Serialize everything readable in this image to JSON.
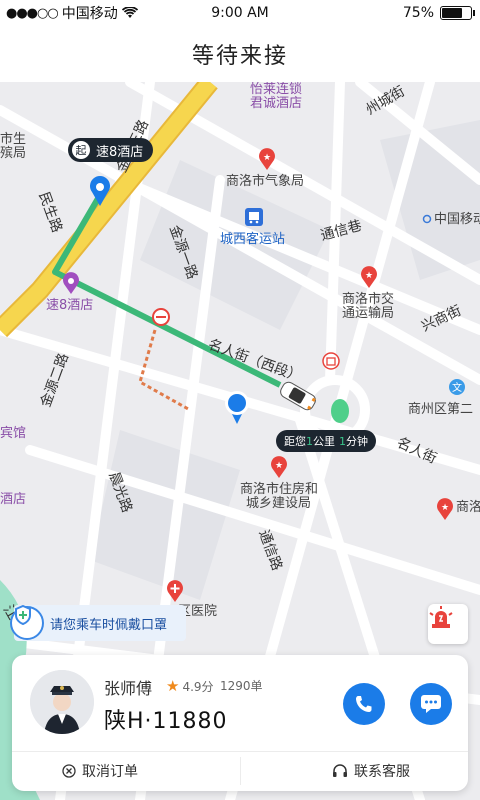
{
  "status_bar": {
    "signal_dots": "●●●○○",
    "carrier": "中国移动",
    "time": "9:00 AM",
    "battery": "75%",
    "battery_level": 0.75
  },
  "nav": {
    "title": "等待来接"
  },
  "map": {
    "pois": [
      {
        "text": "怡莱连锁",
        "style": "purple"
      },
      {
        "text": "君诚酒店",
        "style": "purple"
      },
      {
        "text": "州城街",
        "style": "road"
      },
      {
        "text": "商洛市气象局",
        "style": "normal"
      },
      {
        "text": "城西客运站",
        "style": "blue"
      },
      {
        "text": "通信巷",
        "style": "road"
      },
      {
        "text": "中国移动",
        "style": "normal"
      },
      {
        "text": "商洛市交",
        "style": "normal"
      },
      {
        "text": "通运输局",
        "style": "normal"
      },
      {
        "text": "兴商街",
        "style": "road"
      },
      {
        "text": "速8酒店",
        "style": "purple"
      },
      {
        "text": "民生路",
        "style": "road"
      },
      {
        "text": "金源一路",
        "style": "road"
      },
      {
        "text": "名人街（西段）",
        "style": "road"
      },
      {
        "text": "商州区第二",
        "style": "normal"
      },
      {
        "text": "名人街",
        "style": "road"
      },
      {
        "text": "商洛市住房和",
        "style": "normal"
      },
      {
        "text": "城乡建设局",
        "style": "normal"
      },
      {
        "text": "晨光路",
        "style": "road"
      },
      {
        "text": "通信路",
        "style": "road"
      },
      {
        "text": "商洛",
        "style": "normal"
      },
      {
        "text": "区医院",
        "style": "normal"
      },
      {
        "text": "宾馆",
        "style": "purple"
      },
      {
        "text": "酒店",
        "style": "purple"
      },
      {
        "text": "市生",
        "style": "normal"
      },
      {
        "text": "殡局",
        "style": "normal"
      },
      {
        "text": "江",
        "style": "road"
      },
      {
        "text": "金源二路",
        "style": "road"
      },
      {
        "text": "金源三路",
        "style": "road"
      }
    ],
    "start_tag": {
      "qi": "起",
      "label": "速8酒店"
    },
    "eta_tag": {
      "prefix": "距您",
      "distance": "1",
      "unit1": "公里",
      "time": "1",
      "unit2": "分钟"
    },
    "mask_banner": "请您乘车时佩戴口罩"
  },
  "driver": {
    "name": "张师傅",
    "rating": "4.9分",
    "orders": "1290单",
    "plate": "陕H·11880"
  },
  "actions": {
    "cancel": "取消订单",
    "service": "联系客服"
  },
  "colors": {
    "route": "#3cb878",
    "accent": "#1b7ce8",
    "poi_red": "#e8433c",
    "main_road": "#f6d64e"
  }
}
